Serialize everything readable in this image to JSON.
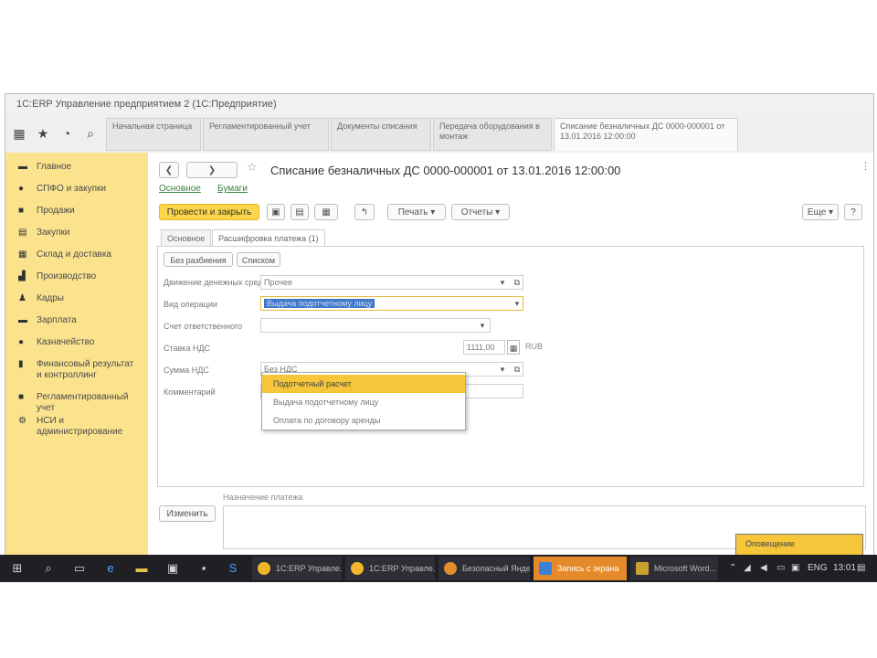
{
  "window": {
    "title": "1С:ERP Управление предприятием 2 (1С:Предприятие)"
  },
  "toolbar_icons": [
    "grid-icon",
    "star-icon",
    "history-icon",
    "search-icon"
  ],
  "open_tabs": [
    {
      "label": "Начальная страница",
      "active": false
    },
    {
      "label": "Регламентированный учет",
      "active": false
    },
    {
      "label": "Документы списания",
      "active": false
    },
    {
      "label": "Передача оборудования в монтаж",
      "active": false
    },
    {
      "label": "Списание безналичных ДС 0000-000001 от 13.01.2016 12:00:00",
      "active": true
    }
  ],
  "sidebar": {
    "items": [
      {
        "icon": "menu-icon",
        "label": "Главное"
      },
      {
        "icon": "circle-icon",
        "label": "СПФО и закупки"
      },
      {
        "icon": "lock-icon",
        "label": "Продажи"
      },
      {
        "icon": "cart-icon",
        "label": "Закупки"
      },
      {
        "icon": "box-icon",
        "label": "Склад и доставка"
      },
      {
        "icon": "factory-icon",
        "label": "Производство"
      },
      {
        "icon": "person-icon",
        "label": "Кадры"
      },
      {
        "icon": "money-icon",
        "label": "Зарплата"
      },
      {
        "icon": "coin-icon",
        "label": "Казначейство"
      },
      {
        "icon": "chart-icon",
        "label": "Финансовый результат и контроллинг"
      },
      {
        "icon": "book-icon",
        "label": "Регламентированный учет"
      },
      {
        "icon": "gear-icon",
        "label": "НСИ и администрирование"
      }
    ]
  },
  "document": {
    "title": "Списание безналичных ДС 0000-000001 от 13.01.2016 12:00:00",
    "links": [
      "Основное",
      "Бумаги"
    ],
    "buttons": {
      "post_close": "Провести и закрыть",
      "print": "Печать",
      "reports": "Отчеты",
      "more": "Еще"
    },
    "tabs": [
      "Основное",
      "Расшифровка платежа (1)"
    ],
    "subbuttons": [
      "Без разбиения",
      "Списком"
    ],
    "fields": {
      "flow_label": "Движение денежных средств",
      "flow_value": "Прочее",
      "type_label": "Вид операции",
      "type_value": "Выдача подотчетному лицу",
      "account_label": "Счет ответственного",
      "tax_label": "Ставка НДС",
      "tax_value": "Без НДС",
      "sum_label": "Сумма НДС",
      "comment_label": "Комментарий",
      "amount_value": "1111,00",
      "currency": "RUB"
    },
    "dropdown_options": [
      {
        "label": "Подотчетный расчет",
        "highlighted": true
      },
      {
        "label": "Выдача подотчетному лицу",
        "highlighted": false
      },
      {
        "label": "Оплата по договору аренды",
        "highlighted": false
      }
    ],
    "bottom": {
      "change_button": "Изменить",
      "note_label": "Назначение платежа"
    }
  },
  "taskbar": {
    "apps": [
      {
        "label": "1С:ERP Управле...",
        "active": false
      },
      {
        "label": "1С:ERP Управле...",
        "active": false
      },
      {
        "label": "Безопасный Яндекс...",
        "active": false
      },
      {
        "label": "Запись с экрана",
        "active": true
      },
      {
        "label": "Microsoft Word...",
        "active": false
      }
    ],
    "lang": "ENG",
    "time": "13:01"
  },
  "notification": {
    "label": "Оповещение"
  }
}
